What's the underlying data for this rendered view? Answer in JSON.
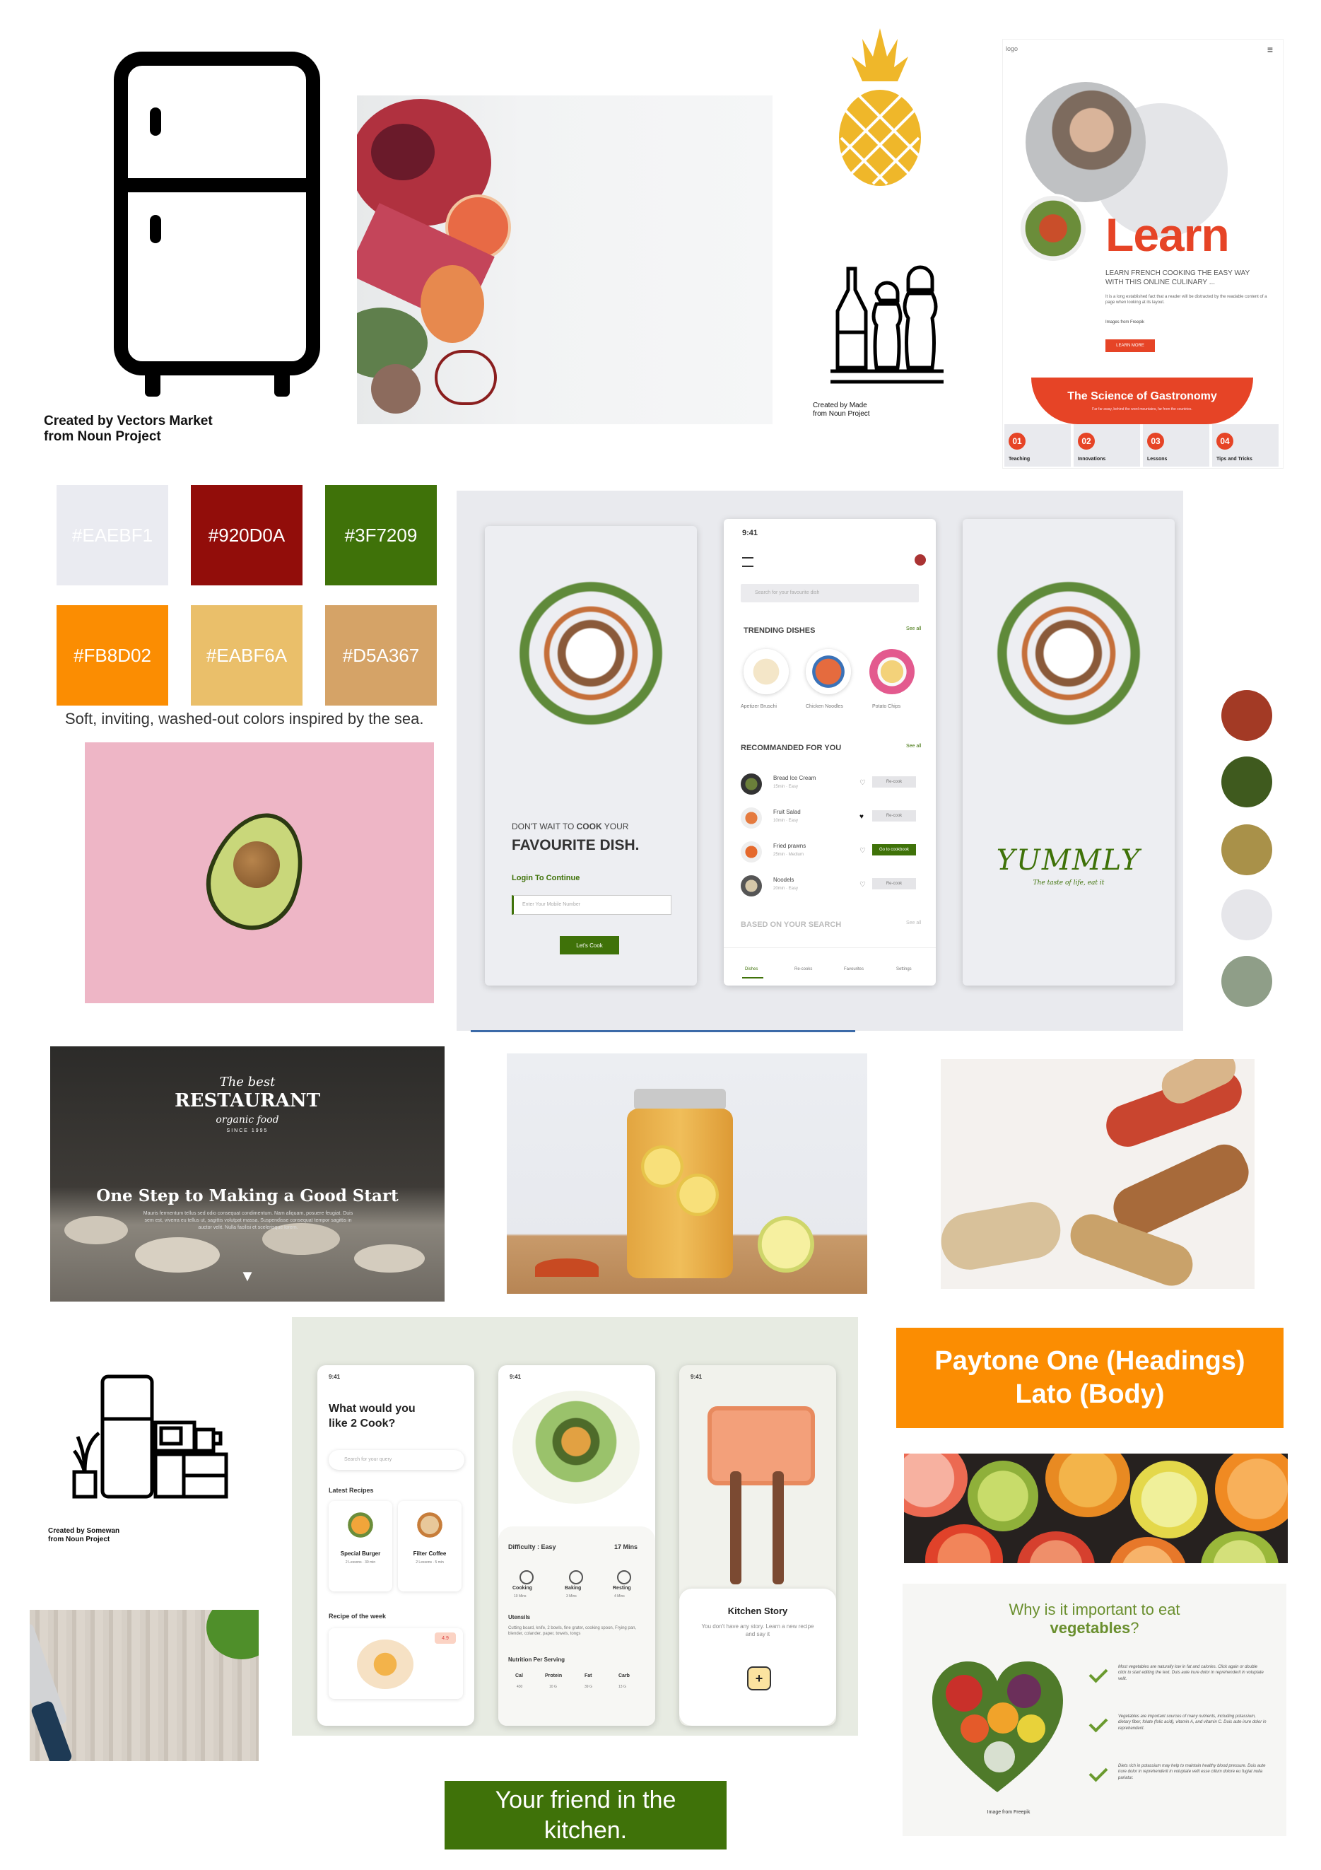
{
  "credits": {
    "fridge": "Created by Vectors Market\nfrom Noun Project",
    "bottles": "Created by Made\nfrom Noun Project",
    "kitchen": "Created by Somewan\nfrom Noun Project"
  },
  "palette": {
    "swatches": [
      {
        "hex": "#EAEBF1",
        "label": "#EAEBF1"
      },
      {
        "hex": "#920D0A",
        "label": "#920D0A"
      },
      {
        "hex": "#3F7209",
        "label": "#3F7209"
      },
      {
        "hex": "#FB8D02",
        "label": "#FB8D02"
      },
      {
        "hex": "#EABF6A",
        "label": "#EABF6A"
      },
      {
        "hex": "#D5A367",
        "label": "#D5A367"
      }
    ],
    "caption": "Soft, inviting, washed-out colors inspired by the sea.",
    "dots": [
      "#A33A25",
      "#3F5A1E",
      "#A99149",
      "#E6E6EA",
      "#8F9E88"
    ]
  },
  "learn_page": {
    "logo": "logo",
    "menu_icon": "≡",
    "title": "Learn",
    "subtitle": "LEARN FRENCH COOKING THE EASY WAY WITH THIS ONLINE CULINARY ...",
    "body": "It is a long established fact that a reader will be distracted by the readable content of a page when looking at its layout.",
    "credit": "Images from Freepik",
    "button": "LEARN MORE",
    "banner_title": "The Science of Gastronomy",
    "banner_sub": "Far far away, behind the word mountains, far from the countries.",
    "steps": [
      {
        "num": "01",
        "label": "Teaching"
      },
      {
        "num": "02",
        "label": "Innovations"
      },
      {
        "num": "03",
        "label": "Lessons"
      },
      {
        "num": "04",
        "label": "Tips and Tricks"
      }
    ]
  },
  "yummly_app": {
    "phone1": {
      "kicker_pre": "DON'T WAIT TO ",
      "kicker_bold": "COOK",
      "kicker_post": " YOUR",
      "headline": "FAVOURITE DISH.",
      "login": "Login To Continue",
      "placeholder": "Enter Your Mobile Number",
      "button": "Let's Cook"
    },
    "phone2": {
      "time": "9:41",
      "search": "Search for your favourite dish",
      "trending": "TRENDING DISHES",
      "see_all": "See all",
      "dishes": [
        "Apetizer Bruschi",
        "Chicken Noodles",
        "Potato Chips"
      ],
      "recommended": "RECOMMANDED FOR YOU",
      "items": [
        {
          "name": "Bread Ice Cream",
          "meta": "15min · Easy",
          "btn": "Re-cook"
        },
        {
          "name": "Fruit Salad",
          "meta": "10min · Easy",
          "btn": "Re-cook"
        },
        {
          "name": "Fried prawns",
          "meta": "25min · Medium",
          "btn": "Go to cookbook"
        },
        {
          "name": "Noodels",
          "meta": "20min · Easy",
          "btn": "Re-cook"
        }
      ],
      "based": "BASED ON YOUR SEARCH",
      "nav": [
        "Dishes",
        "Re-cooks",
        "Favourites",
        "Settings"
      ]
    },
    "phone3": {
      "logo": "YUMMLY",
      "tagline": "The taste of life, eat it"
    }
  },
  "restaurant": {
    "badge_top": "The best",
    "badge_main": "RESTAURANT",
    "badge_sub": "organic food",
    "badge_since": "SINCE 1995",
    "headline": "One Step to Making a Good Start",
    "body": "Mauris fermentum tellus sed odio consequat condimentum. Nam aliquam, posuere feugiat. Duis sem est, viverra eu tellus ut, sagittis volutpat massa. Suspendisse consequat tempor sagittis in auctor velit. Nulla facilisi et scelerisque lorem.",
    "arrow": "▼"
  },
  "fonts_box": {
    "line1": "Paytone One (Headings)",
    "line2": "Lato (Body)"
  },
  "cook_app": {
    "time": "9:41",
    "question": "What would you like 2 Cook?",
    "search": "Search for your query",
    "latest": "Latest Recipes",
    "recipes": [
      {
        "name": "Special Burger",
        "meta": "2 Lessons · 30 min"
      },
      {
        "name": "Filter Coffee",
        "meta": "2 Lessons · 5 min"
      }
    ],
    "week": "Recipe of the week",
    "rating": "4.9",
    "difficulty": "Difficulty : Easy",
    "mins": "17 Mins",
    "steps": [
      {
        "name": "Cooking",
        "time": "10 Mins"
      },
      {
        "name": "Baking",
        "time": "3 Mins"
      },
      {
        "name": "Resting",
        "time": "4 Mins"
      }
    ],
    "utensils": "Utensils",
    "utensils_text": "Cutting board, knife, 2 bowls, fine grater, cooking spoon, Frying pan, blender, colander, paper, towels, tongs",
    "nutrition": "Nutrition Per Serving",
    "nutri": [
      {
        "k": "Cal",
        "v": "430"
      },
      {
        "k": "Protein",
        "v": "10 G"
      },
      {
        "k": "Fat",
        "v": "39 G"
      },
      {
        "k": "Carb",
        "v": "13 G"
      }
    ],
    "story_title": "Kitchen Story",
    "story_text": "You don't have any story. Learn a new recipe and say it",
    "plus": "+"
  },
  "vegetables": {
    "q_pre": "Why is it important to eat",
    "q_bold": "vegetables",
    "q_post": "?",
    "points": [
      "Most vegetables are naturally low in fat and calories. Click again or double click to start editing the text. Duis aute irure dolor in reprehenderit in voluptate velit.",
      "Vegetables are important sources of many nutrients, including potassium, dietary fiber, folate (folic acid), vitamin A, and vitamin C. Duis aute irure dolor in reprehenderit.",
      "Diets rich in potassium may help to maintain healthy blood pressure. Duis aute irure dolor in reprehenderit in voluptate velit esse cillum dolore eu fugiat nulla pariatur."
    ],
    "credit": "Image from Freepik"
  },
  "tagline": "Your friend in the kitchen."
}
